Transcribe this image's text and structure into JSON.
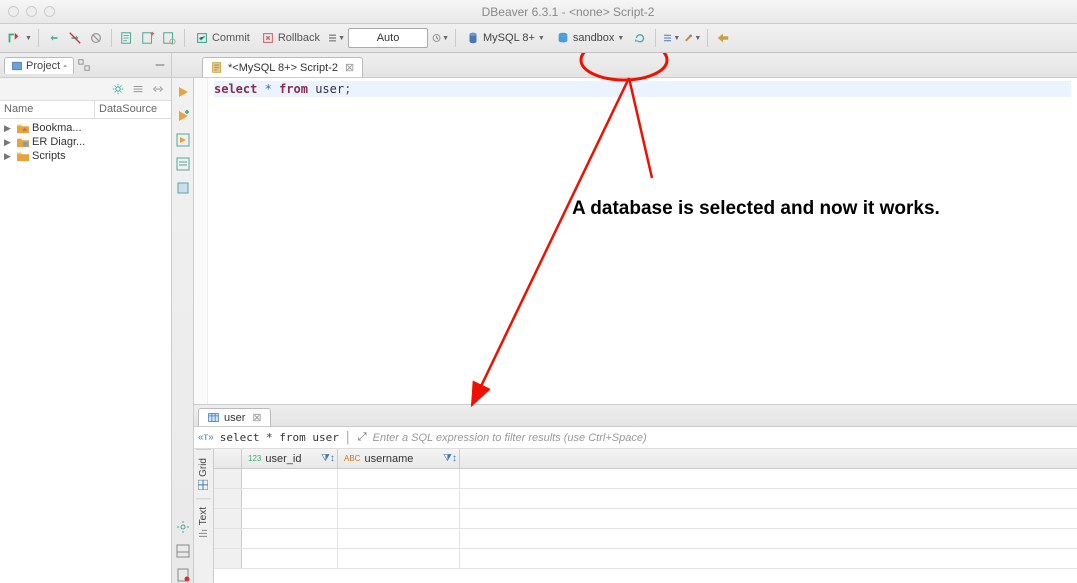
{
  "window": {
    "title": "DBeaver 6.3.1 - <none> Script-2"
  },
  "toolbar": {
    "commit_label": "Commit",
    "rollback_label": "Rollback",
    "mode_combo": "Auto",
    "datasource_label": "MySQL 8+",
    "database_label": "sandbox"
  },
  "project_panel": {
    "tab_label": "Project -",
    "header_name": "Name",
    "header_datasource": "DataSource",
    "tree": [
      {
        "label": "Bookma..."
      },
      {
        "label": "ER Diagr..."
      },
      {
        "label": "Scripts"
      }
    ]
  },
  "editor": {
    "tab_label": "*<MySQL 8+> Script-2",
    "sql": {
      "kw_select": "select",
      "star": "*",
      "kw_from": "from",
      "table": "user",
      "semi": ";"
    }
  },
  "results": {
    "tab_label": "user",
    "query_label": "select * from user",
    "filter_placeholder": "Enter a SQL expression to filter results (use Ctrl+Space)",
    "side_tab_grid": "Grid",
    "side_tab_text": "Text",
    "columns": [
      {
        "name": "user_id",
        "type_prefix": "123"
      },
      {
        "name": "username",
        "type_prefix": "ABC"
      }
    ],
    "row_count": 5
  },
  "annotation": {
    "text": "A database is selected and now it works."
  }
}
